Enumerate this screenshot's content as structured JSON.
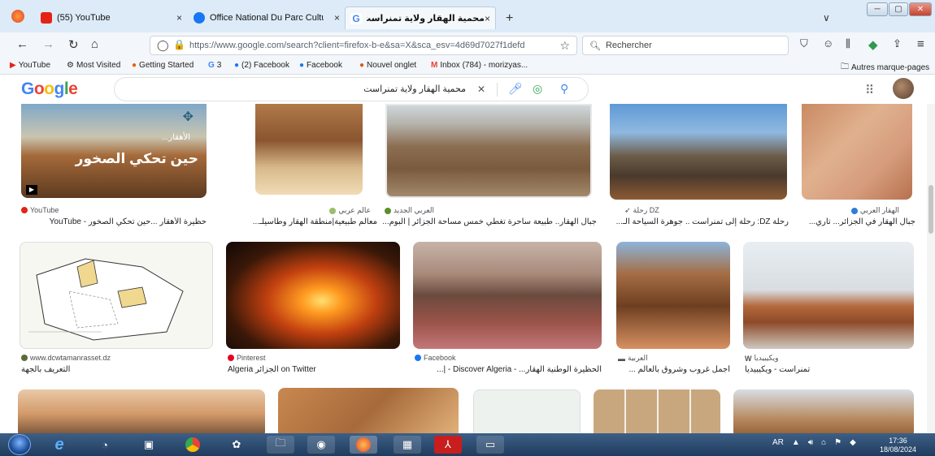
{
  "browser": {
    "tabs": [
      {
        "label": "(55) YouTube",
        "close": "×"
      },
      {
        "label": "Office National Du Parc Culture",
        "close": "×"
      },
      {
        "label": "محمية الهقار ولاية تمنراست - Google",
        "close": "×"
      }
    ],
    "new_tab": "+",
    "tab_list": "∨",
    "window_controls": [
      "─",
      "▢",
      "✕"
    ],
    "url": "https://www.google.com/search?client=firefox-b-e&sa=X&sca_esv=4d69d7027f1defd",
    "search_placeholder": "Rechercher",
    "bookmarks": [
      {
        "label": "YouTube",
        "icon": "youtube-icon"
      },
      {
        "label": "Most Visited",
        "icon": "gear-icon"
      },
      {
        "label": "Getting Started",
        "icon": "firefox-icon"
      },
      {
        "label": "3",
        "icon": "google-icon"
      },
      {
        "label": "(2) Facebook",
        "icon": "facebook-icon"
      },
      {
        "label": "Facebook",
        "icon": "facebook-icon"
      },
      {
        "label": "Nouvel onglet",
        "icon": "globe-icon"
      },
      {
        "label": "Inbox (784) - morizyas...",
        "icon": "gmail-icon"
      }
    ],
    "other_bookmarks": "Autres marque-pages"
  },
  "google": {
    "logo": "Google",
    "query": "محمية الهقار ولاية تمنراست",
    "clear": "✕"
  },
  "results": {
    "row1": [
      {
        "source": "YouTube",
        "caption": "حظيرة الأهقار ...حين تحكي الصخور - YouTube",
        "overlay": "حين تحكي الصخور",
        "overlay_small": "الأهقار..."
      },
      {
        "source": "عالم عربي",
        "caption": "معالم طبيعية|منطقة الهقار وطاسيلـ..."
      },
      {
        "source": "العربي الجديد",
        "caption": "جبال الهقار.. طبيعة ساحرة تغطي خمس مساحة الجزائر | البوم..."
      },
      {
        "source": "رحلة DZ",
        "caption": "رحلة DZ: رحلة إلى تمنراست .. جوهرة السياحة الـ..."
      },
      {
        "source": "الهقار العربي",
        "caption": "جبال الهقار في الجزائر... تاري..."
      }
    ],
    "row2": [
      {
        "source": "www.dcwtamanrasset.dz",
        "caption": "التعريف بالجهة"
      },
      {
        "source": "Pinterest",
        "caption": "Algeria الجزائر on Twitter"
      },
      {
        "source": "Facebook",
        "caption": "الحظيرة الوطنية الهقار... - Discover Algeria - |..."
      },
      {
        "source": "العربية",
        "caption": "أجمل غروب وشروق بالعالم ..."
      },
      {
        "source": "ويكيبيديا",
        "caption": "تمنراست - ويكيبيديا"
      }
    ]
  },
  "taskbar": {
    "lang": "AR",
    "time": "17:36",
    "date": "18/08/2024"
  },
  "colors": {
    "google_blue": "#4285f4",
    "google_red": "#ea4335",
    "google_yellow": "#fbbc05",
    "google_green": "#34a853"
  }
}
